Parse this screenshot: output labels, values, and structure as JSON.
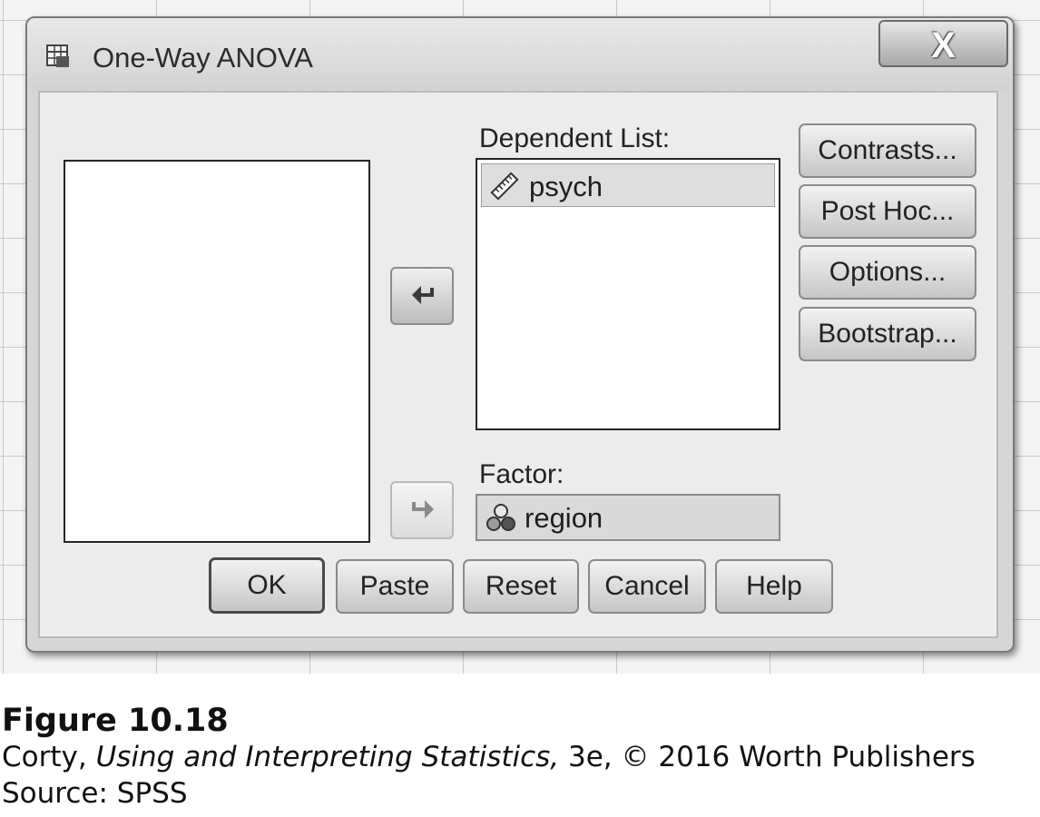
{
  "window": {
    "title": "One-Way ANOVA",
    "close_label": "X"
  },
  "dependent_list": {
    "label": "Dependent List:",
    "items": [
      {
        "name": "psych",
        "icon": "ruler-scale-icon"
      }
    ]
  },
  "factor": {
    "label": "Factor:",
    "value": "region",
    "icon": "nominal-circles-icon"
  },
  "side_buttons": [
    {
      "label": "Contrasts..."
    },
    {
      "label": "Post Hoc..."
    },
    {
      "label": "Options..."
    },
    {
      "label": "Bootstrap..."
    }
  ],
  "bottom_buttons": [
    {
      "label": "OK"
    },
    {
      "label": "Paste"
    },
    {
      "label": "Reset"
    },
    {
      "label": "Cancel"
    },
    {
      "label": "Help"
    }
  ],
  "caption": {
    "figure": "Figure 10.18",
    "author": "Corty, ",
    "book_title": "Using and Interpreting Statistics,",
    "rest": " 3e, © 2016 Worth Publishers",
    "source": "Source: SPSS"
  }
}
